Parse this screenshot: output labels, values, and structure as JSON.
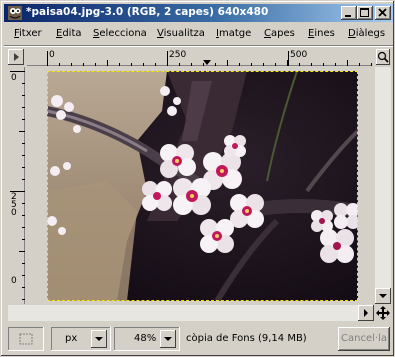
{
  "window": {
    "title": "*paisa04.jpg-3.0 (RGB, 2 capes) 640x480",
    "title_bar_color": "#0a246a",
    "selection_color": "#f5e600"
  },
  "menubar": {
    "items": [
      {
        "label": "Fitxer",
        "accel": "F"
      },
      {
        "label": "Edita",
        "accel": "E"
      },
      {
        "label": "Selecciona",
        "accel": "S"
      },
      {
        "label": "Visualitza",
        "accel": "V"
      },
      {
        "label": "Imatge",
        "accel": "I"
      },
      {
        "label": "Capes",
        "accel": "C"
      },
      {
        "label": "Eines",
        "accel": "E"
      },
      {
        "label": "Diàlegs",
        "accel": "D"
      }
    ]
  },
  "rulers": {
    "horizontal": [
      "0",
      "250",
      "500"
    ],
    "vertical": [
      "0",
      "0",
      "0",
      "0"
    ]
  },
  "statusbar": {
    "unit": "px",
    "zoom": "48%",
    "layer_info": "còpia de Fons (9,14 MB)",
    "cancel_label": "Cancel·la"
  },
  "icons": {
    "app": "gimp-wilber-icon",
    "minimize": "minimize-icon",
    "maximize": "maximize-icon",
    "close": "close-icon",
    "menu_arrow": "menu-arrow-icon",
    "navigate": "navigate-icon",
    "move": "move-cross-icon",
    "quick_mask": "quick-mask-icon"
  }
}
